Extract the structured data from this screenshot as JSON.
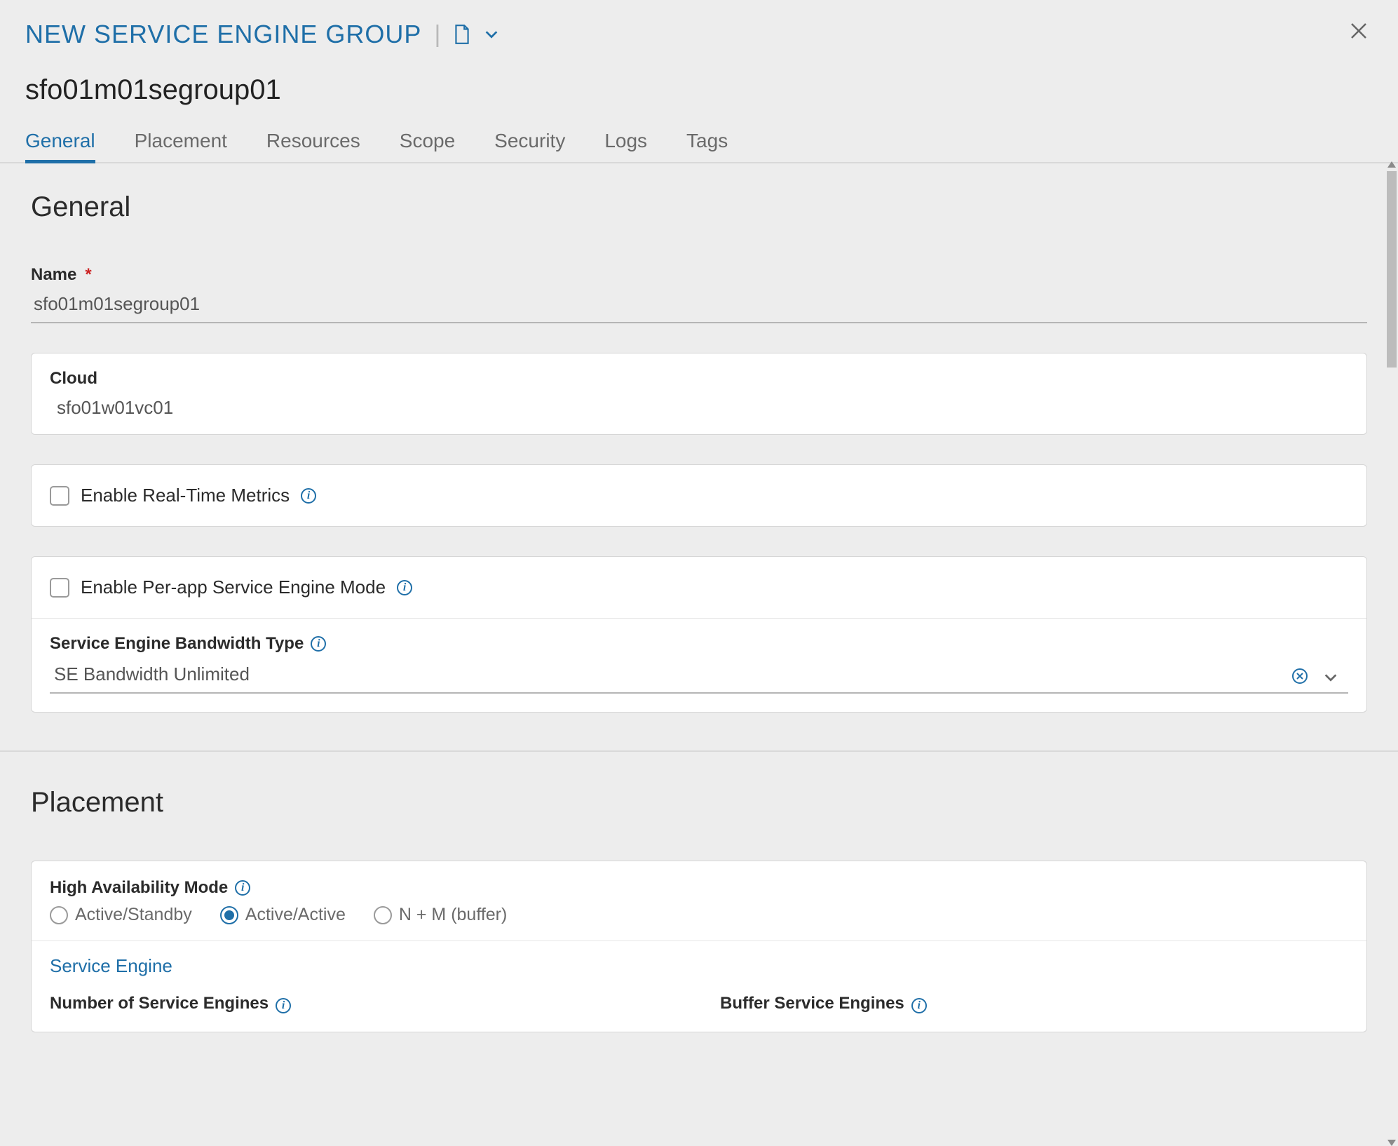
{
  "header": {
    "title": "NEW SERVICE ENGINE GROUP",
    "entity_name": "sfo01m01segroup01"
  },
  "tabs": [
    {
      "label": "General",
      "active": true
    },
    {
      "label": "Placement",
      "active": false
    },
    {
      "label": "Resources",
      "active": false
    },
    {
      "label": "Scope",
      "active": false
    },
    {
      "label": "Security",
      "active": false
    },
    {
      "label": "Logs",
      "active": false
    },
    {
      "label": "Tags",
      "active": false
    }
  ],
  "general": {
    "section_title": "General",
    "name_label": "Name",
    "name_value": "sfo01m01segroup01",
    "cloud_label": "Cloud",
    "cloud_value": "sfo01w01vc01",
    "metrics_label": "Enable Real-Time Metrics",
    "metrics_checked": false,
    "perapp_label": "Enable Per-app Service Engine Mode",
    "perapp_checked": false,
    "bandwidth_label": "Service Engine Bandwidth Type",
    "bandwidth_value": "SE Bandwidth Unlimited"
  },
  "placement": {
    "section_title": "Placement",
    "ha_label": "High Availability Mode",
    "ha_options": [
      {
        "label": "Active/Standby",
        "selected": false
      },
      {
        "label": "Active/Active",
        "selected": true
      },
      {
        "label": "N + M (buffer)",
        "selected": false
      }
    ],
    "service_engine_link": "Service Engine",
    "num_se_label": "Number of Service Engines",
    "buffer_se_label": "Buffer Service Engines"
  }
}
